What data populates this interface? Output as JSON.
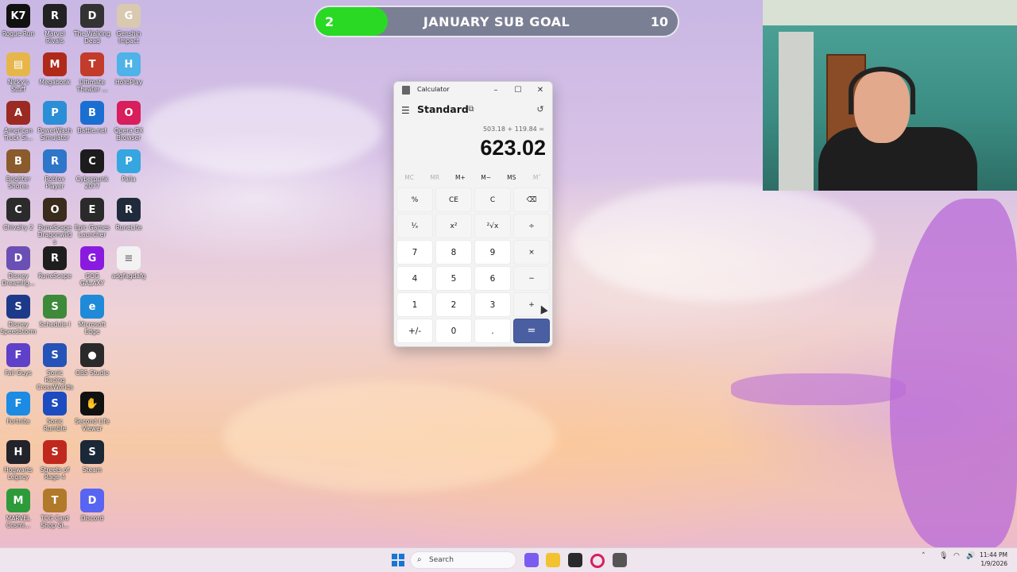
{
  "colors": {
    "accent": "#4a5fa2",
    "goal_fill": "#29d924",
    "goal_bg": "#7b7f94"
  },
  "sub_goal": {
    "current": "2",
    "title": "JANUARY SUB GOAL",
    "target": "10",
    "progress": 0.2
  },
  "desktop_icons": [
    {
      "label": "Rogue Run",
      "color": "#111",
      "glyph": "K7"
    },
    {
      "label": "Marvel Rivals",
      "color": "#222",
      "glyph": "R"
    },
    {
      "label": "The Walking Dead",
      "color": "#333",
      "glyph": "D"
    },
    {
      "label": "Genshin Impact",
      "color": "#d8c9b0",
      "glyph": "G"
    },
    {
      "label": "Nicky's Stuff",
      "color": "#e6b64a",
      "glyph": "▤"
    },
    {
      "label": "Megabonk",
      "color": "#b02a1a",
      "glyph": "M"
    },
    {
      "label": "Ultimate Theater ...",
      "color": "#c23b2b",
      "glyph": "T"
    },
    {
      "label": "HoYoPlay",
      "color": "#4fb2e8",
      "glyph": "H"
    },
    {
      "label": "American Truck Si...",
      "color": "#9b2a22",
      "glyph": "A"
    },
    {
      "label": "PowerWash Simulator",
      "color": "#2a8fd6",
      "glyph": "P"
    },
    {
      "label": "Battle.net",
      "color": "#1b6fd1",
      "glyph": "B"
    },
    {
      "label": "Opera GX Browser",
      "color": "#d81e5b",
      "glyph": "O"
    },
    {
      "label": "Brighter Shores",
      "color": "#8a5b2c",
      "glyph": "B"
    },
    {
      "label": "Roblox Player",
      "color": "#2e76c9",
      "glyph": "R"
    },
    {
      "label": "Cyberpunk 2077",
      "color": "#1c1c1c",
      "glyph": "C"
    },
    {
      "label": "Palia",
      "color": "#35a6e0",
      "glyph": "P"
    },
    {
      "label": "Chivalry 2",
      "color": "#2b2b2b",
      "glyph": "C"
    },
    {
      "label": "RuneScape Dragonwilds",
      "color": "#3a2c1c",
      "glyph": "O"
    },
    {
      "label": "Epic Games Launcher",
      "color": "#2a2a2a",
      "glyph": "E"
    },
    {
      "label": "RuneLite",
      "color": "#1f2b3a",
      "glyph": "R"
    },
    {
      "label": "Disney Dreamlig...",
      "color": "#6a4fb4",
      "glyph": "D"
    },
    {
      "label": "RuneScape",
      "color": "#1e1e1e",
      "glyph": "R"
    },
    {
      "label": "GOG GALAXY",
      "color": "#8b1ae0",
      "glyph": "G"
    },
    {
      "label": "adgfagdafg",
      "color": "#f2f2f2",
      "glyph": "≡"
    },
    {
      "label": "Disney Speedstorm",
      "color": "#1d3a8a",
      "glyph": "S"
    },
    {
      "label": "Schedule I",
      "color": "#3d8a3a",
      "glyph": "S"
    },
    {
      "label": "Microsoft Edge",
      "color": "#1f8ad8",
      "glyph": "e"
    },
    {
      "label": "",
      "color": "transparent",
      "glyph": ""
    },
    {
      "label": "Fall Guys",
      "color": "#5e40c9",
      "glyph": "F"
    },
    {
      "label": "Sonic Racing CrossWorlds",
      "color": "#2653b8",
      "glyph": "S"
    },
    {
      "label": "OBS Studio",
      "color": "#2a2a2a",
      "glyph": "●"
    },
    {
      "label": "",
      "color": "transparent",
      "glyph": ""
    },
    {
      "label": "Fortnite",
      "color": "#1b8be3",
      "glyph": "F"
    },
    {
      "label": "Sonic Rumble",
      "color": "#1d4cc0",
      "glyph": "S"
    },
    {
      "label": "Second Life Viewer",
      "color": "#111",
      "glyph": "✋"
    },
    {
      "label": "",
      "color": "transparent",
      "glyph": ""
    },
    {
      "label": "Hogwarts Legacy",
      "color": "#23232b",
      "glyph": "H"
    },
    {
      "label": "Streets of Rage 4",
      "color": "#c0281e",
      "glyph": "S"
    },
    {
      "label": "Steam",
      "color": "#1b2838",
      "glyph": "S"
    },
    {
      "label": "",
      "color": "transparent",
      "glyph": ""
    },
    {
      "label": "MARVEL Cosmi...",
      "color": "#2d9b3a",
      "glyph": "M"
    },
    {
      "label": "TCG Card Shop Si...",
      "color": "#b07a2a",
      "glyph": "T"
    },
    {
      "label": "Discord",
      "color": "#5865f2",
      "glyph": "D"
    }
  ],
  "calculator": {
    "window_title": "Calculator",
    "minimize": "–",
    "maximize": "☐",
    "close": "✕",
    "menu_icon": "☰",
    "mode": "Standard",
    "keep_on_top_icon": "⧉",
    "history_icon": "↺",
    "expression": "503.18 + 119.84 =",
    "result": "623.02",
    "memory": [
      {
        "label": "MC",
        "enabled": false
      },
      {
        "label": "MR",
        "enabled": false
      },
      {
        "label": "M+",
        "enabled": true
      },
      {
        "label": "M−",
        "enabled": true
      },
      {
        "label": "MS",
        "enabled": true
      },
      {
        "label": "M˅",
        "enabled": false
      }
    ],
    "keys": [
      {
        "label": "%",
        "type": "fn",
        "name": "percent-key"
      },
      {
        "label": "CE",
        "type": "fn",
        "name": "clear-entry-key"
      },
      {
        "label": "C",
        "type": "fn",
        "name": "clear-key"
      },
      {
        "label": "⌫",
        "type": "fn",
        "name": "backspace-key"
      },
      {
        "label": "¹⁄ₓ",
        "type": "fn",
        "name": "reciprocal-key"
      },
      {
        "label": "x²",
        "type": "fn",
        "name": "square-key"
      },
      {
        "label": "²√x",
        "type": "fn",
        "name": "square-root-key"
      },
      {
        "label": "÷",
        "type": "fn",
        "name": "divide-key"
      },
      {
        "label": "7",
        "type": "num",
        "name": "digit-7-key"
      },
      {
        "label": "8",
        "type": "num",
        "name": "digit-8-key"
      },
      {
        "label": "9",
        "type": "num",
        "name": "digit-9-key"
      },
      {
        "label": "×",
        "type": "fn",
        "name": "multiply-key"
      },
      {
        "label": "4",
        "type": "num",
        "name": "digit-4-key"
      },
      {
        "label": "5",
        "type": "num",
        "name": "digit-5-key"
      },
      {
        "label": "6",
        "type": "num",
        "name": "digit-6-key"
      },
      {
        "label": "−",
        "type": "fn",
        "name": "subtract-key"
      },
      {
        "label": "1",
        "type": "num",
        "name": "digit-1-key"
      },
      {
        "label": "2",
        "type": "num",
        "name": "digit-2-key"
      },
      {
        "label": "3",
        "type": "num",
        "name": "digit-3-key"
      },
      {
        "label": "+",
        "type": "fn",
        "name": "add-key"
      },
      {
        "label": "+/-",
        "type": "num",
        "name": "negate-key"
      },
      {
        "label": "0",
        "type": "num",
        "name": "digit-0-key"
      },
      {
        "label": ".",
        "type": "num",
        "name": "decimal-key"
      },
      {
        "label": "=",
        "type": "eq",
        "name": "equals-key"
      }
    ]
  },
  "taskbar": {
    "search_placeholder": "Search",
    "search_icon": "⌕",
    "apps": [
      {
        "name": "copilot-icon",
        "color": "#7b5cf0"
      },
      {
        "name": "file-explorer-icon",
        "color": "#f2c230"
      },
      {
        "name": "obs-studio-icon",
        "color": "#2a2a2a"
      },
      {
        "name": "opera-gx-icon",
        "color": "#d81e5b"
      },
      {
        "name": "calculator-icon",
        "color": "#555"
      }
    ],
    "tray_chevron": "˄",
    "time": "11:44 PM",
    "date": "1/9/2026"
  }
}
